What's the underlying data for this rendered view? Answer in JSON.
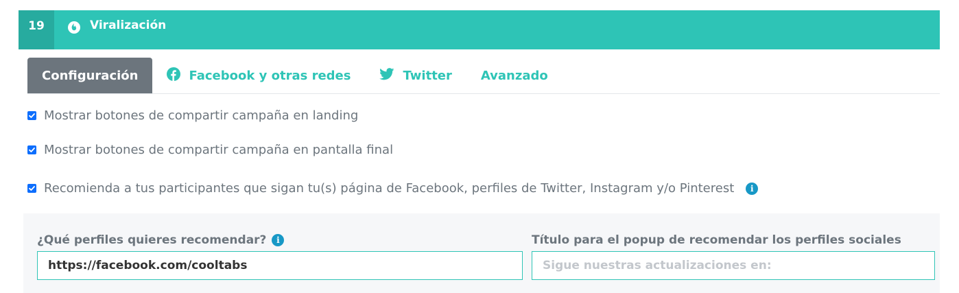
{
  "section": {
    "number": "19",
    "title": "Viralización",
    "icon": "fire-icon"
  },
  "tabs": [
    {
      "label": "Configuración",
      "active": true,
      "icon": ""
    },
    {
      "label": "Facebook y otras redes",
      "active": false,
      "icon": "facebook-icon"
    },
    {
      "label": "Twitter",
      "active": false,
      "icon": "twitter-icon"
    },
    {
      "label": "Avanzado",
      "active": false,
      "icon": ""
    }
  ],
  "options": [
    {
      "label": "Mostrar botones de compartir campaña en landing",
      "checked": true
    },
    {
      "label": "Mostrar botones de compartir campaña en pantalla final",
      "checked": true
    },
    {
      "label": "Recomienda a tus participantes que sigan tu(s) página de Facebook, perfiles de Twitter, Instagram y/o Pinterest",
      "checked": true
    }
  ],
  "form": {
    "profiles_label": "¿Qué perfiles quieres recomendar?",
    "profiles_value": "https://facebook.com/cooltabs",
    "popup_title_label": "Título para el popup de recomendar los perfiles sociales",
    "popup_title_placeholder": "Sigue nuestras actualizaciones en:",
    "popup_title_value": ""
  },
  "colors": {
    "accent": "#2ec4b6",
    "accent_dark": "#27ab9f",
    "tab_active": "#6c757d",
    "checkbox": "#0d6efd",
    "info": "#1798c6"
  }
}
